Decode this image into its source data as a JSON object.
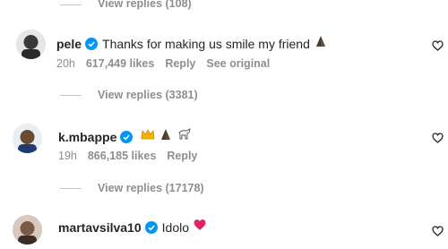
{
  "top_thread": {
    "view_replies_label": "View replies (108)"
  },
  "comments": [
    {
      "username": "pele",
      "verified": true,
      "text": "Thanks for making us smile my friend",
      "emojis": [
        "folded-hands"
      ],
      "time": "20h",
      "likes": "617,449 likes",
      "reply_label": "Reply",
      "see_original_label": "See original",
      "view_replies_label": "View replies (3381)"
    },
    {
      "username": "k.mbappe",
      "verified": true,
      "text": "",
      "emojis": [
        "crown",
        "folded-hands",
        "goat"
      ],
      "time": "19h",
      "likes": "866,185 likes",
      "reply_label": "Reply",
      "view_replies_label": "View replies (17178)"
    },
    {
      "username": "martavsilva10",
      "verified": true,
      "text": "Idolo",
      "emojis": [
        "red-heart"
      ]
    }
  ],
  "colors": {
    "verified_blue": "#0095f6",
    "muted": "#8e8e8e",
    "text": "#262626",
    "heart_red": "#e0245e"
  }
}
